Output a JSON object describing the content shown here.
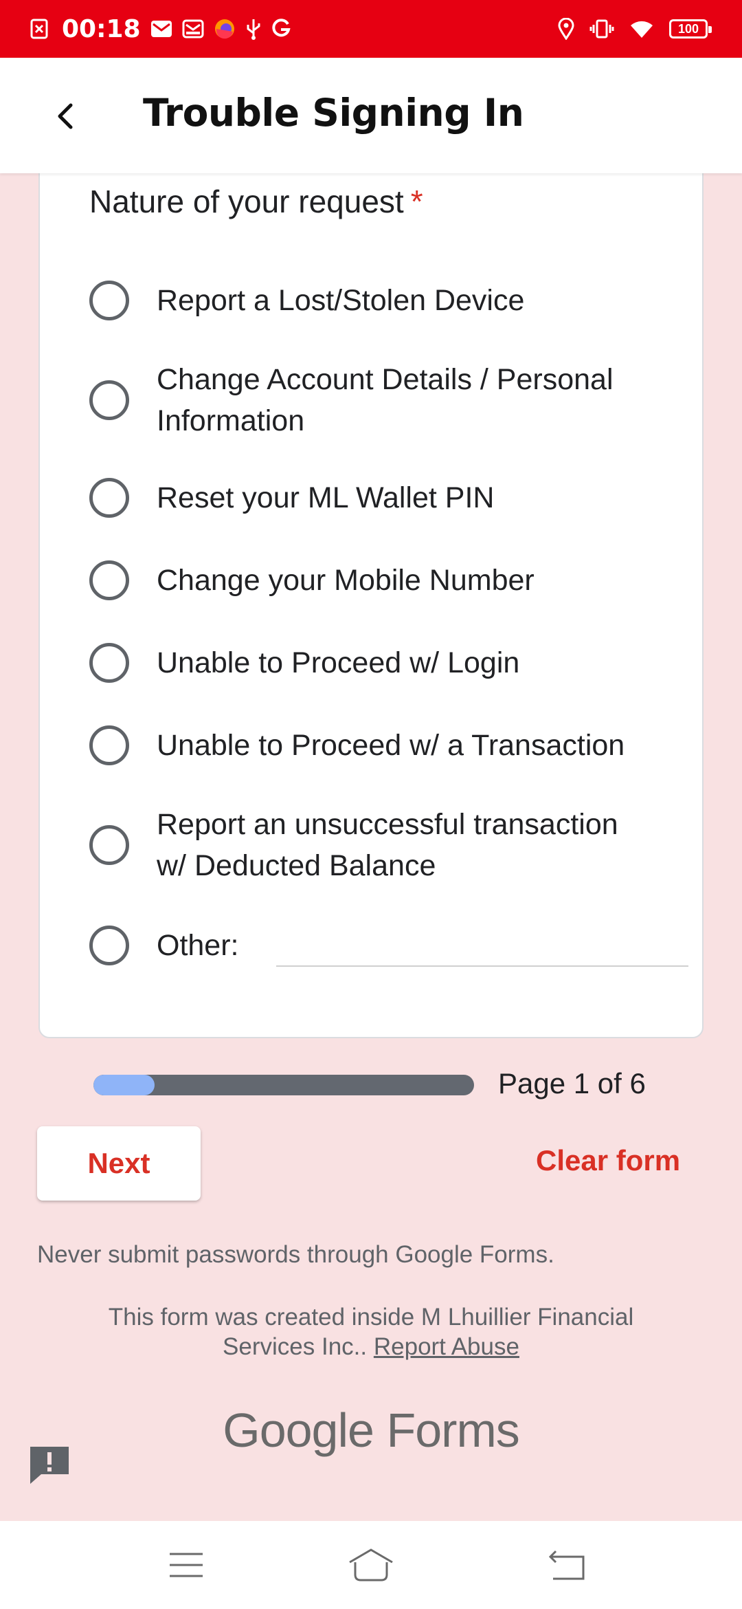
{
  "status_bar": {
    "time": "00:18",
    "battery": "100",
    "background_color": "#e60012"
  },
  "app_bar": {
    "title": "Trouble Signing In"
  },
  "form": {
    "question": "Nature of your request",
    "required_marker": "*",
    "options": [
      "Report a Lost/Stolen Device",
      "Change Account Details / Personal Information",
      "Reset your ML Wallet PIN",
      "Change your Mobile Number",
      "Unable to Proceed w/ Login",
      "Unable to Proceed w/ a Transaction",
      "Report an unsuccessful transaction w/ Deducted Balance",
      "Other:"
    ]
  },
  "progress": {
    "text": "Page 1 of 6",
    "fraction": 0.16
  },
  "buttons": {
    "next": "Next",
    "clear": "Clear form"
  },
  "footer": {
    "warning": "Never submit passwords through Google Forms.",
    "created_by": "This form was created inside M Lhuillier Financial Services Inc..",
    "report_abuse": "Report Abuse",
    "brand_google": "Google",
    "brand_forms": "Forms"
  },
  "colors": {
    "page_bg": "#f9e1e2",
    "accent": "#d93025",
    "progress_fill": "#8fb4f8",
    "progress_track": "#636870"
  }
}
